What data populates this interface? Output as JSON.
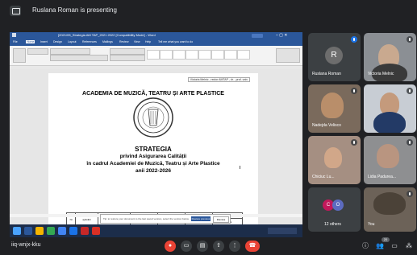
{
  "meeting": {
    "presenting_text": "Ruslana Roman is presenting",
    "code": "iiq-wnjx-kku",
    "others_count_label": "12 others",
    "participants_badge": "20"
  },
  "presentation": {
    "window_title": "[2021/05_Strategia AM TAP_2021 2022 [Compatibility Mode] - Word",
    "menu": [
      "File",
      "Home",
      "Insert",
      "Design",
      "Layout",
      "References",
      "Mailings",
      "Review",
      "View",
      "Help",
      "Tell me what you want to do"
    ],
    "header_box": "Victoria Melnic , rector AMTAP , dr. , prof. univ",
    "doc_heading": "ACADEMIA DE MUZICĂ, TEATRU ȘI ARTE PLASTICE",
    "doc_title": "STRATEGIA",
    "doc_subtitle1": "privind Asigurarea Calității",
    "doc_subtitle2": "în cadrul Academiei de Muzică, Teatru și Arte Plastice",
    "doc_years": "anii 2022-2026",
    "table_headers": [
      "Nr.",
      "Revizia/Data aplicării",
      "Numărul capitolului și al paginilor revizuite",
      "Rubrica, Prenumele",
      "Elaborat",
      "Verificat",
      "Avizat",
      "Aprobat"
    ],
    "notification_text": "Tip: to restore your document to the last saved version, select the version below",
    "notification_btn_primary": "Restore previous",
    "notification_btn_secondary": "Dismiss"
  },
  "participants": [
    {
      "name": "Ruslana Roman",
      "initial": "R"
    },
    {
      "name": "Victoria Melnic"
    },
    {
      "name": ""
    },
    {
      "name": "Nadejda Velisco"
    },
    {
      "name": ""
    },
    {
      "name": "Chiciuc Lu..."
    },
    {
      "name": "Lidia Padurea..."
    },
    {
      "name": "You"
    }
  ],
  "colors": {
    "meet_bg": "#202124",
    "tile_bg": "#3c4043",
    "word_blue": "#2b579a",
    "end_call_red": "#ea4335",
    "others_avatar_1": "#c2185b",
    "others_avatar_2": "#5c6bc0"
  },
  "icons": {
    "mic": "mic-off-icon",
    "camera": "camera-icon",
    "captions": "captions-icon",
    "present": "present-icon",
    "more": "more-options-icon",
    "end": "end-call-icon",
    "info": "info-icon",
    "people": "people-icon",
    "chat": "chat-icon",
    "activities": "activities-icon"
  },
  "others_initials": [
    "C",
    "O"
  ]
}
